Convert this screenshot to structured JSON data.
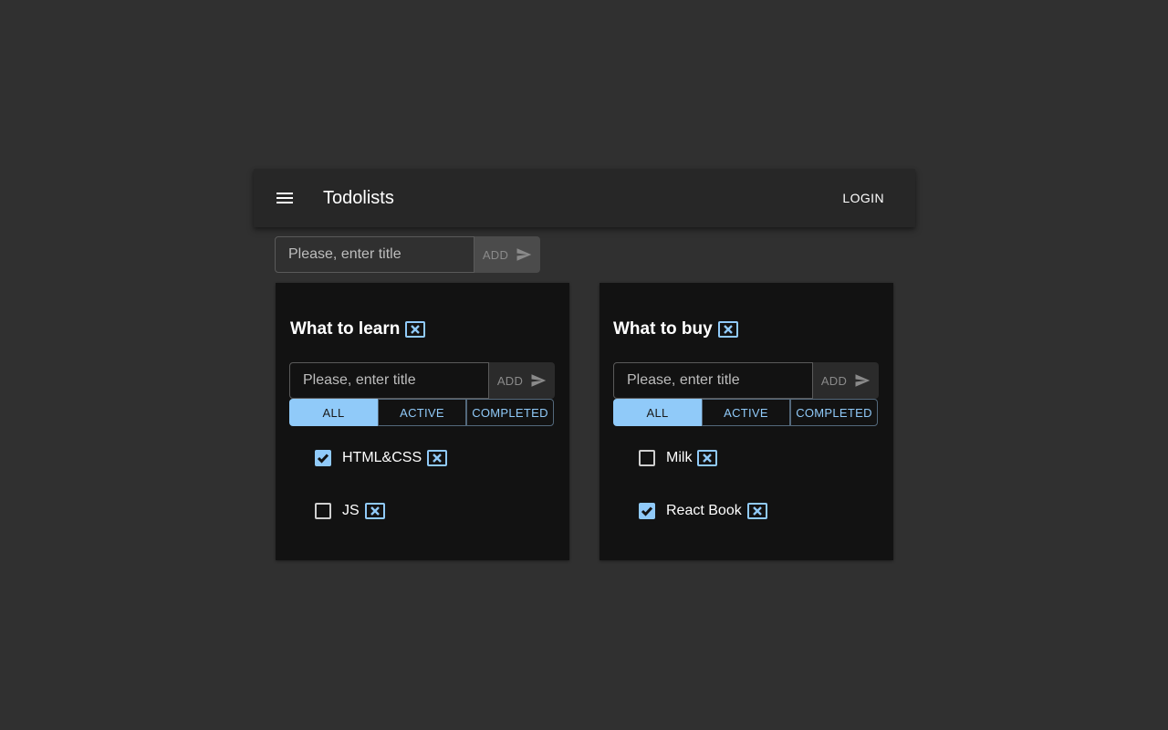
{
  "appbar": {
    "title": "Todolists",
    "login_label": "LOGIN",
    "menu_icon": "menu-icon"
  },
  "new_list_form": {
    "placeholder": "Please, enter title",
    "add_label": "ADD",
    "add_icon": "send-icon"
  },
  "filters": [
    "ALL",
    "ACTIVE",
    "COMPLETED"
  ],
  "todolists": [
    {
      "title": "What to learn",
      "form": {
        "placeholder": "Please, enter title",
        "add_label": "ADD"
      },
      "selected_filter": "ALL",
      "tasks": [
        {
          "title": "HTML&CSS",
          "done": true
        },
        {
          "title": "JS",
          "done": false
        }
      ]
    },
    {
      "title": "What to buy",
      "form": {
        "placeholder": "Please, enter title",
        "add_label": "ADD"
      },
      "selected_filter": "ALL",
      "tasks": [
        {
          "title": "Milk",
          "done": false
        },
        {
          "title": "React Book",
          "done": true
        }
      ]
    }
  ],
  "colors": {
    "background": "#303030",
    "appbar": "#272727",
    "card": "#121212",
    "accent": "#90caf9"
  }
}
